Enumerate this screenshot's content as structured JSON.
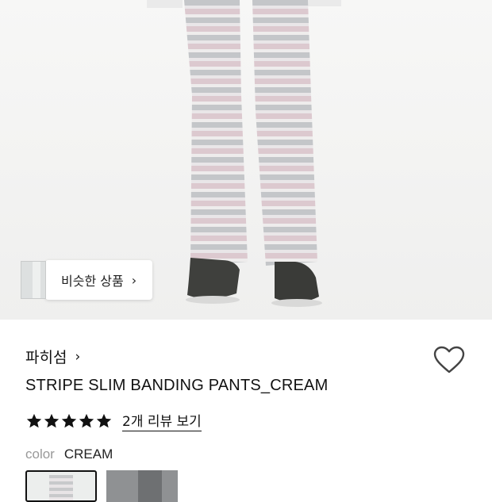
{
  "similar": {
    "label": "비슷한 상품",
    "chevron": "›"
  },
  "brand": {
    "name": "파히섬",
    "chevron": "›"
  },
  "product": {
    "title": "STRIPE SLIM BANDING PANTS_CREAM"
  },
  "rating": {
    "stars": 5,
    "reviews_label": "2개 리뷰 보기"
  },
  "color": {
    "label": "color",
    "value": "CREAM"
  },
  "icons": {
    "heart": "heart-outline-icon",
    "star": "star-icon",
    "chevron": "chevron-right-icon"
  },
  "colors": {
    "text": "#111111",
    "muted": "#999999",
    "star": "#111111"
  }
}
